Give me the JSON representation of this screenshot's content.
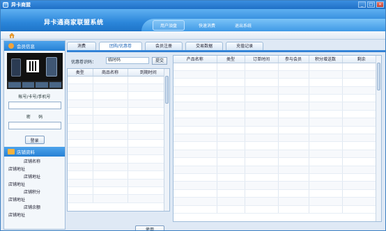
{
  "window": {
    "title": "异卡商盟",
    "controls": [
      "_",
      "□",
      "×"
    ]
  },
  "header": {
    "logo": "异卡通商家联盟系统",
    "nav": [
      "用户須盘",
      "快速消费",
      "退出系统"
    ]
  },
  "sidebar": {
    "member_title": "会员信息",
    "account_label": "帐号/卡号/手机号",
    "password_label": "密      码",
    "login_button": "登录",
    "shop_title": "店铺资料",
    "shop_rows": [
      {
        "text": "店铺名称",
        "indent": true
      },
      {
        "text": "店铺地址",
        "indent": false
      },
      {
        "text": "店铺地址",
        "indent": true
      },
      {
        "text": "店铺地址",
        "indent": false
      },
      {
        "text": "店铺积分",
        "indent": true
      },
      {
        "text": "店铺地址",
        "indent": false
      },
      {
        "text": "店铺余额",
        "indent": true
      },
      {
        "text": "店铺地址",
        "indent": false
      }
    ]
  },
  "tabs": [
    "消费",
    "团购/优惠卷",
    "会员注册",
    "交易数据",
    "充值记录"
  ],
  "active_tab": 1,
  "coupon": {
    "label": "优惠卷识码：",
    "input_value": "临时码",
    "submit_button": "提交",
    "columns": [
      "类型",
      "商品名称",
      "到期时间"
    ],
    "use_button": "使用"
  },
  "orders": {
    "columns": [
      "产品名称",
      "类型",
      "订单时间",
      "参与会员",
      "积分增送数",
      "剩余"
    ]
  }
}
